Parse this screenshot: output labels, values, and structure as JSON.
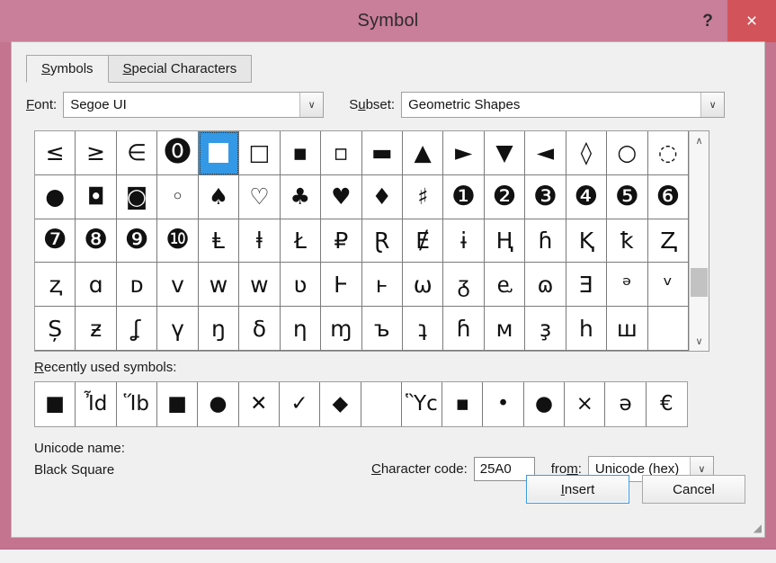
{
  "window": {
    "title": "Symbol",
    "help_glyph": "?",
    "close_glyph": "×",
    "titlebar_color": "#c97e99",
    "frame_color": "#c4748f",
    "close_button_color": "#d2545a"
  },
  "tabs": [
    {
      "label": "Symbols",
      "accel": "S",
      "rest": "ymbols",
      "active": true
    },
    {
      "label": "Special Characters",
      "accel": "S",
      "rest": "pecial Characters",
      "active": false
    }
  ],
  "selectors": {
    "font_label": "Font:",
    "font_accel": "F",
    "font_label_rest": "ont:",
    "font_value": "Segoe UI",
    "subset_label": "Subset:",
    "subset_accel": "u",
    "subset_value": "Geometric Shapes",
    "dropdown_arrow": "∨"
  },
  "grid": {
    "selected_index": 4,
    "selected_code": "25A0",
    "rows": [
      [
        "≤",
        "≥",
        "∈",
        "⓿",
        "■",
        "□",
        "▪",
        "▫",
        "▬",
        "▲",
        "►",
        "▼",
        "◄",
        "◊",
        "○",
        "◌"
      ],
      [
        "●",
        "◘",
        "◙",
        "◦",
        "♠",
        "♡",
        "♣",
        "♥",
        "♦",
        "♯",
        "❶",
        "❷",
        "❸",
        "❹",
        "❺",
        "❻"
      ],
      [
        "❼",
        "❽",
        "❾",
        "❿",
        "Ⱡ",
        "ⱡ",
        "Ł",
        "₽",
        "Ɽ",
        "Ɇ",
        "ɨ",
        "Ⱨ",
        "ɦ",
        "Ⱪ",
        "ꝁ",
        "Ⱬ"
      ],
      [
        "ⱬ",
        "ɑ",
        "ᴅ",
        "ᴠ",
        "ᴡ",
        "ᴡ",
        "ʋ",
        "Ⱶ",
        "ⱶ",
        "ω",
        "ᵹ",
        "ⱸ",
        "ɷ",
        "Ǝ",
        "ᵊ",
        "ᵛ"
      ],
      [
        "Ș",
        "ƶ",
        "ʆ",
        "ү",
        "ŋ",
        "δ",
        "η",
        "ɱ",
        "ъ",
        "ʇ",
        "ɦ",
        "м",
        "ҙ",
        "հ",
        "ш",
        ""
      ]
    ]
  },
  "recent": {
    "label": "Recently used symbols:",
    "accel": "R",
    "label_rest": "ecently used symbols:",
    "symbols": [
      "■",
      "Ἶd",
      "Ἵb",
      "■",
      "●",
      "✕",
      "✓",
      "◆",
      "",
      "Ὓc",
      "▪",
      "•",
      "●",
      "×",
      "ә",
      "€"
    ]
  },
  "info": {
    "unicode_name_label": "Unicode name:",
    "unicode_name_value": "Black Square",
    "charcode_label": "Character code:",
    "charcode_accel": "C",
    "charcode_label_rest": "haracter code:",
    "charcode_value": "25A0",
    "from_label": "from:",
    "from_accel": "m",
    "from_value": "Unicode (hex)"
  },
  "buttons": {
    "insert_label": "Insert",
    "insert_accel": "I",
    "insert_rest": "nsert",
    "cancel_label": "Cancel"
  },
  "scrollbar": {
    "up_glyph": "∧",
    "down_glyph": "∨"
  }
}
